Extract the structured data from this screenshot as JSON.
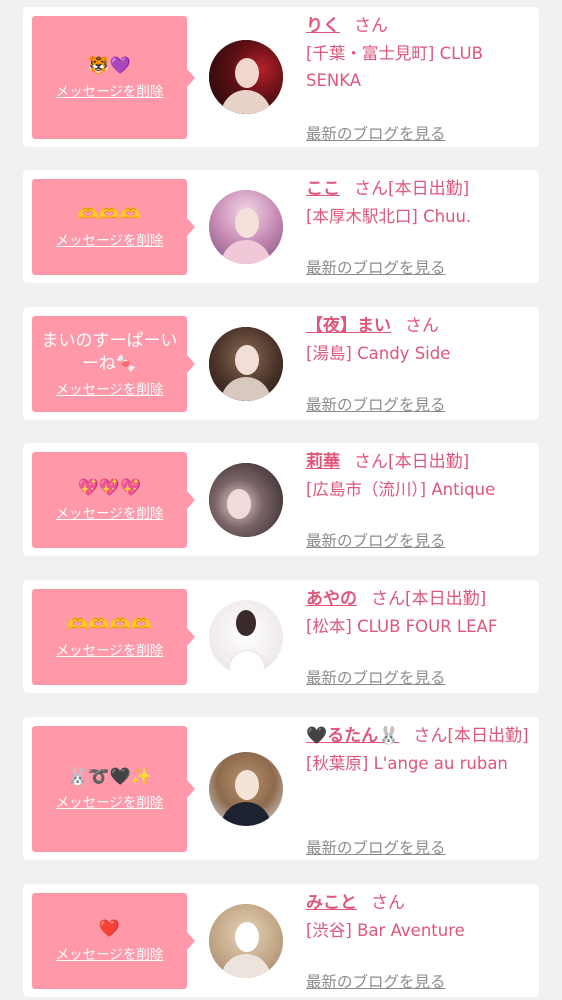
{
  "delete_label": "メッセージを削除",
  "blog_label": "最新のブログを見る",
  "honorific": "さん",
  "colors": {
    "accent_pink": "#e0567a",
    "bubble_pink": "#ff98a8",
    "link_gray": "#8c8c8c",
    "background": "#f1f1f1"
  },
  "items": [
    {
      "message": "🐯💜",
      "name": "りく",
      "suffix": "さん",
      "shop": "[千葉・富士見町] CLUB SENKA"
    },
    {
      "message": "🫶🫶🫶",
      "name": "ここ",
      "suffix": "さん[本日出勤]",
      "shop": "[本厚木駅北口] Chuu."
    },
    {
      "message": "まいのすーぱーいーね🍬",
      "name": "【夜】まい",
      "suffix": "さん",
      "shop": "[湯島] Candy Side"
    },
    {
      "message": "💖💖💖",
      "name": "莉華",
      "suffix": "さん[本日出勤]",
      "shop": "[広島市（流川）] Antique"
    },
    {
      "message": "🫶🫶🫶🫶",
      "name": "あやの",
      "suffix": "さん[本日出勤]",
      "shop": "[松本] CLUB FOUR LEAF"
    },
    {
      "message": "🐰➰🖤✨",
      "name": "🖤るたん🐰",
      "suffix": "さん[本日出勤]",
      "shop": "[秋葉原] L'ange au ruban"
    },
    {
      "message": "❤️",
      "name": "みこと",
      "suffix": "さん",
      "shop": "[渋谷] Bar Aventure"
    }
  ]
}
